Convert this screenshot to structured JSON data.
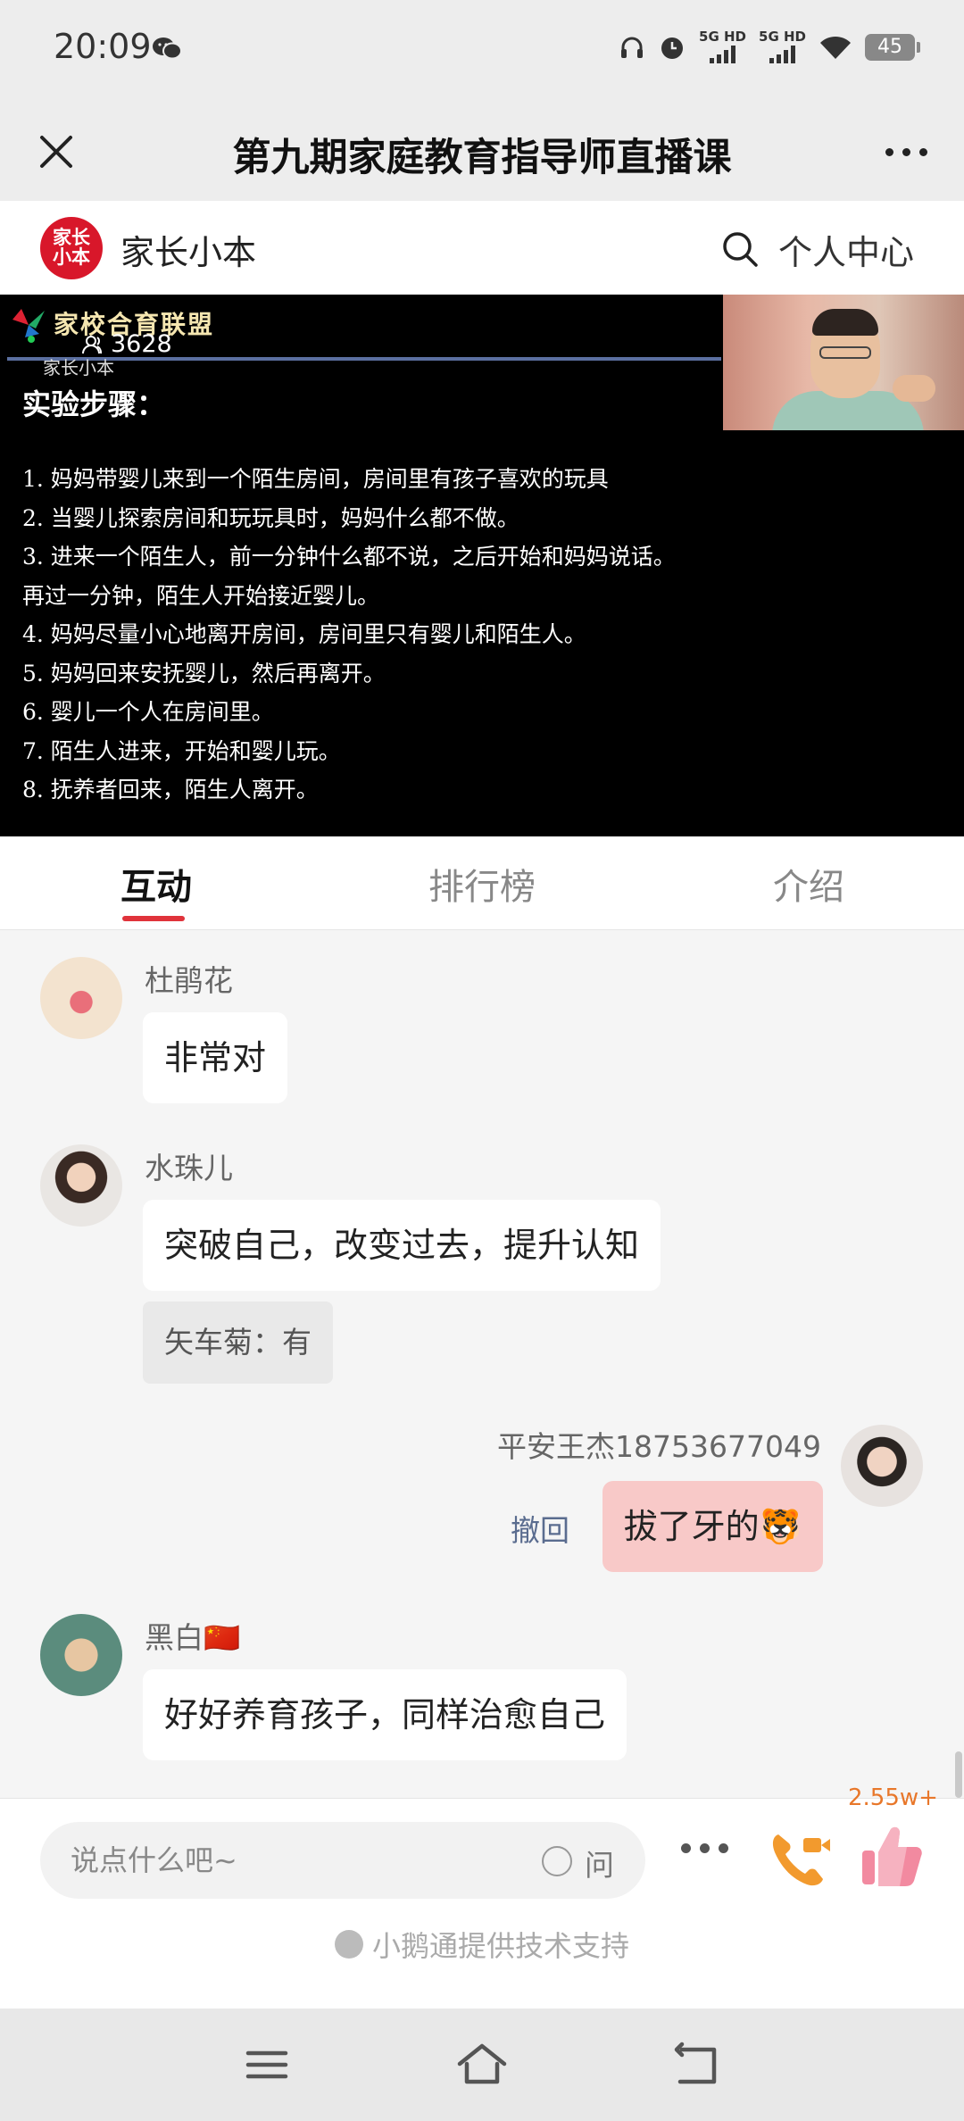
{
  "status_bar": {
    "time": "20:09",
    "network_1": "5G HD",
    "network_2": "5G HD",
    "battery": "45"
  },
  "title_bar": {
    "title": "第九期家庭教育指导师直播课"
  },
  "app_header": {
    "logo_text_line1": "家长",
    "logo_text_line2": "小本",
    "app_name": "家长小本",
    "personal_center": "个人中心"
  },
  "video": {
    "overlay_brand": "家校合育联盟",
    "overlay_sub": "家长小本",
    "viewer_count": "3628",
    "slide_heading": "实验步骤：",
    "steps": [
      "1. 妈妈带婴儿来到一个陌生房间，房间里有孩子喜欢的玩具",
      "2. 当婴儿探索房间和玩玩具时，妈妈什么都不做。",
      "3. 进来一个陌生人，前一分钟什么都不说，之后开始和妈妈说话。",
      "再过一分钟，陌生人开始接近婴儿。",
      "4. 妈妈尽量小心地离开房间，房间里只有婴儿和陌生人。",
      "5. 妈妈回来安抚婴儿，然后再离开。",
      "6. 婴儿一个人在房间里。",
      "7. 陌生人进来，开始和婴儿玩。",
      "8. 抚养者回来，陌生人离开。"
    ]
  },
  "tabs": [
    {
      "label": "互动",
      "active": true
    },
    {
      "label": "排行榜",
      "active": false
    },
    {
      "label": "介绍",
      "active": false
    }
  ],
  "messages": [
    {
      "user": "杜鹃花",
      "text": "非常对"
    },
    {
      "user": "水珠儿",
      "text": "突破自己，改变过去，提升认知",
      "quote": "矢车菊：有"
    },
    {
      "user": "平安王杰18753677049",
      "text": "拔了牙的🐯",
      "recall": "撤回",
      "mine": true
    },
    {
      "user": "黑白🇨🇳",
      "text": "好好养育孩子，同样治愈自己"
    }
  ],
  "input_bar": {
    "placeholder": "说点什么吧~",
    "ask_label": "问",
    "like_count": "2.55w+",
    "powered_by": "小鹅通提供技术支持"
  },
  "colors": {
    "accent_red": "#e0333b",
    "brand_red": "#d8172a",
    "mine_bubble": "#f8c9c8",
    "call_orange": "#f29a2e",
    "like_pink": "#f28aa0"
  }
}
